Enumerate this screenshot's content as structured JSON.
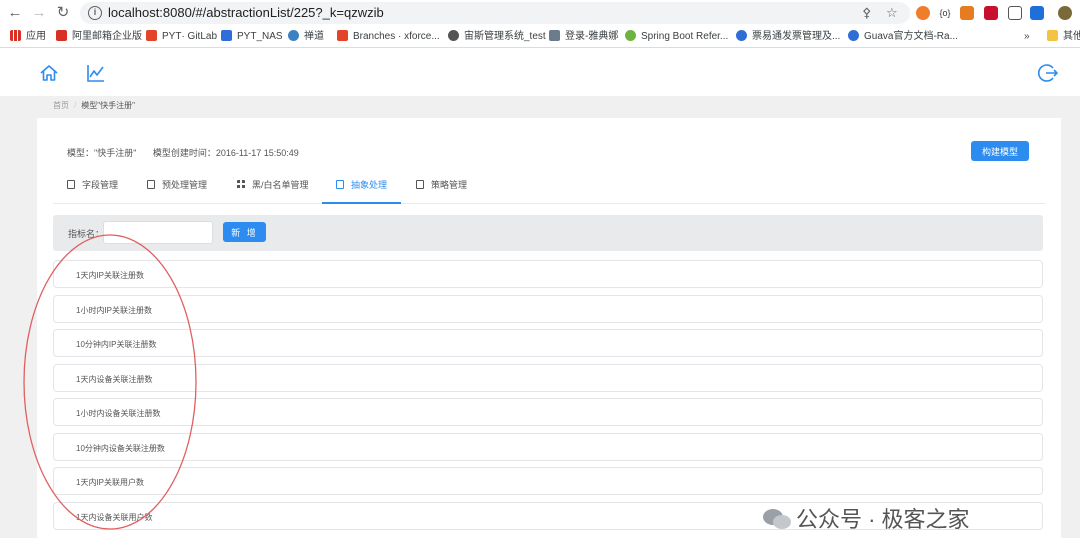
{
  "browser": {
    "url": "localhost:8080/#/abstractionList/225?_k=qzwzib",
    "bookmarks": [
      "应用",
      "阿里邮箱企业版",
      "PYT· GitLab",
      "PYT_NAS",
      "禅道",
      "Branches · xforce...",
      "宙斯管理系统_test",
      "登录-雅典娜",
      "Spring Boot Refer...",
      "票易通发票管理及...",
      "Guava官方文档-Ra...",
      "其他"
    ],
    "more_bookmarks": "»"
  },
  "breadcrumb": {
    "home": "首页",
    "separator": "/",
    "current": "模型\"快手注册\""
  },
  "model": {
    "name_label": "模型：\"快手注册\"",
    "created_label": "模型创建时间：2016-11-17 15:50:49",
    "build_button": "构建模型"
  },
  "tabs": [
    {
      "label": "字段管理",
      "active": false
    },
    {
      "label": "预处理管理",
      "active": false
    },
    {
      "label": "黑/白名单管理",
      "active": false
    },
    {
      "label": "抽象处理",
      "active": true
    },
    {
      "label": "策略管理",
      "active": false
    }
  ],
  "filter": {
    "label": "指标名：",
    "input_value": "",
    "add_button": "新 增"
  },
  "indicators": [
    "1天内IP关联注册数",
    "1小时内IP关联注册数",
    "10分钟内IP关联注册数",
    "1天内设备关联注册数",
    "1小时内设备关联注册数",
    "10分钟内设备关联注册数",
    "1天内IP关联用户数",
    "1天内设备关联用户数"
  ],
  "watermark": "公众号 · 极客之家",
  "colors": {
    "primary": "#2d8cf0",
    "annotation": "#e06060",
    "filter_bg": "#e9eaec"
  }
}
